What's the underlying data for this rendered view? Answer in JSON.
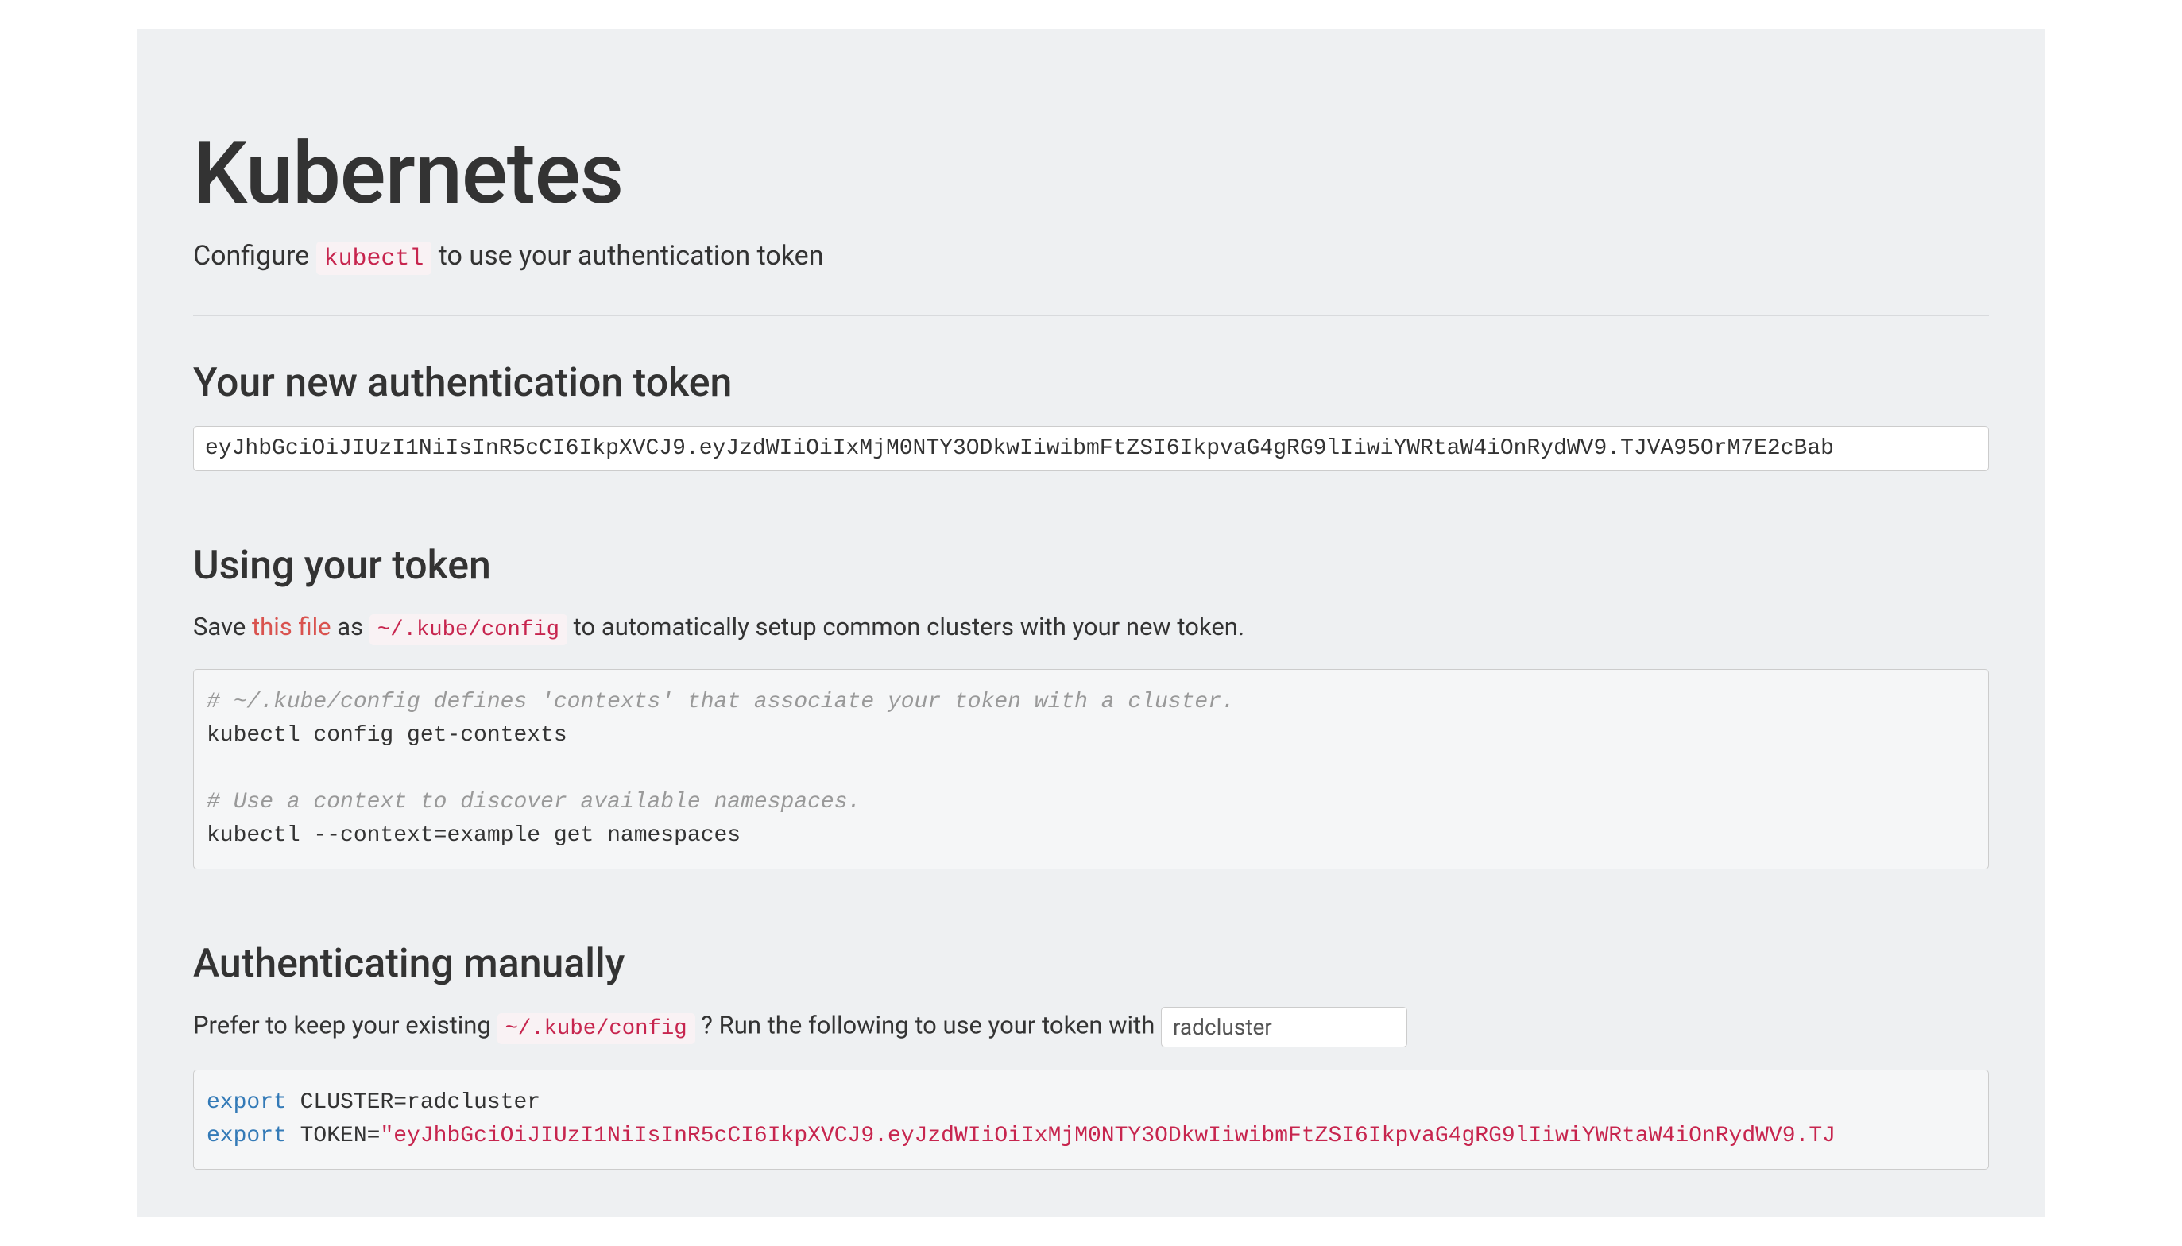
{
  "page": {
    "title": "Kubernetes",
    "subtitle_prefix": "Configure ",
    "subtitle_code": "kubectl",
    "subtitle_suffix": " to use your authentication token"
  },
  "section_token": {
    "heading": "Your new authentication token",
    "token_value": "eyJhbGciOiJIUzI1NiIsInR5cCI6IkpXVCJ9.eyJzdWIiOiIxMjM0NTY3ODkwIiwibmFtZSI6IkpvaG4gRG9lIiwiYWRtaW4iOnRydWV9.TJVA95OrM7E2cBab"
  },
  "section_using": {
    "heading": "Using your token",
    "para_prefix": "Save ",
    "link_text": "this file",
    "para_mid": " as ",
    "code_path": "~/.kube/config",
    "para_suffix": " to automatically setup common clusters with your new token.",
    "code": {
      "comment1": "# ~/.kube/config defines 'contexts' that associate your token with a cluster.",
      "line1": "kubectl config get-contexts",
      "comment2": "# Use a context to discover available namespaces.",
      "line2": "kubectl --context=example get namespaces"
    }
  },
  "section_manual": {
    "heading": "Authenticating manually",
    "para_prefix": "Prefer to keep your existing ",
    "code_path": "~/.kube/config",
    "para_mid": " ? Run the following to use your token with ",
    "cluster_value": "radcluster",
    "code": {
      "kw_export": "export",
      "line1_rest": " CLUSTER=radcluster",
      "line2_token_prefix": " TOKEN=",
      "line2_token_string": "\"eyJhbGciOiJIUzI1NiIsInR5cCI6IkpXVCJ9.eyJzdWIiOiIxMjM0NTY3ODkwIiwibmFtZSI6IkpvaG4gRG9lIiwiYWRtaW4iOnRydWV9.TJ"
    }
  }
}
